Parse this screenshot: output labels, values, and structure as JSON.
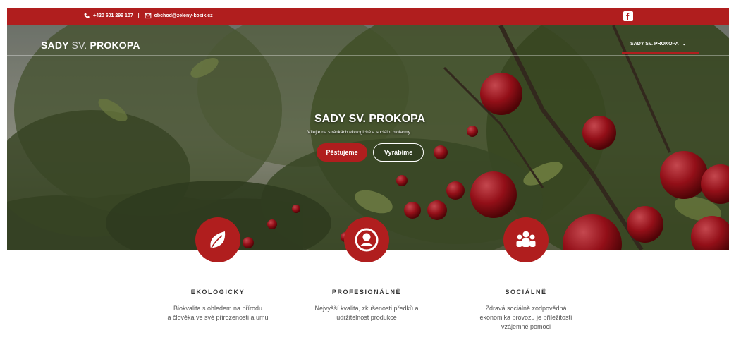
{
  "topbar": {
    "phone": "+420 601 299 107",
    "separator": "|",
    "email": "obchod@zeleny-kosik.cz",
    "icons": [
      "phone-icon",
      "mail-icon",
      "facebook-icon"
    ]
  },
  "nav": {
    "logo_bold": "SADY",
    "logo_light": "SV.",
    "logo_rest": "PROKOPA",
    "menu_label": "SADY SV. PROKOPA",
    "menu_chevron": "⌄"
  },
  "hero": {
    "title": "SADY SV. PROKOPA",
    "subtitle": "Vítejte na stránkách ekologické a sociální biofarmy.",
    "btn_primary": "Pěstujeme",
    "btn_secondary": "Vyrábíme"
  },
  "features": [
    {
      "icon": "leaf-icon",
      "title": "EKOLOGICKY",
      "line1": "Biokvalita s ohledem na přírodu",
      "line2": "a člověka ve své přirozenosti a umu"
    },
    {
      "icon": "user-circle-icon",
      "title": "PROFESIONÁLNĚ",
      "line1": "Nejvyšší kvalita, zkušenosti předků a",
      "line2": "udržitelnost produkce"
    },
    {
      "icon": "group-icon",
      "title": "SOCIÁLNĚ",
      "line1": "Zdravá sociálně zodpovědná",
      "line2": "ekonomika provozu je příležitostí",
      "line3": "vzájemné pomoci"
    }
  ],
  "colors": {
    "brand_red": "#b01e1e",
    "text_dark": "#333333",
    "text_body": "#555555"
  }
}
